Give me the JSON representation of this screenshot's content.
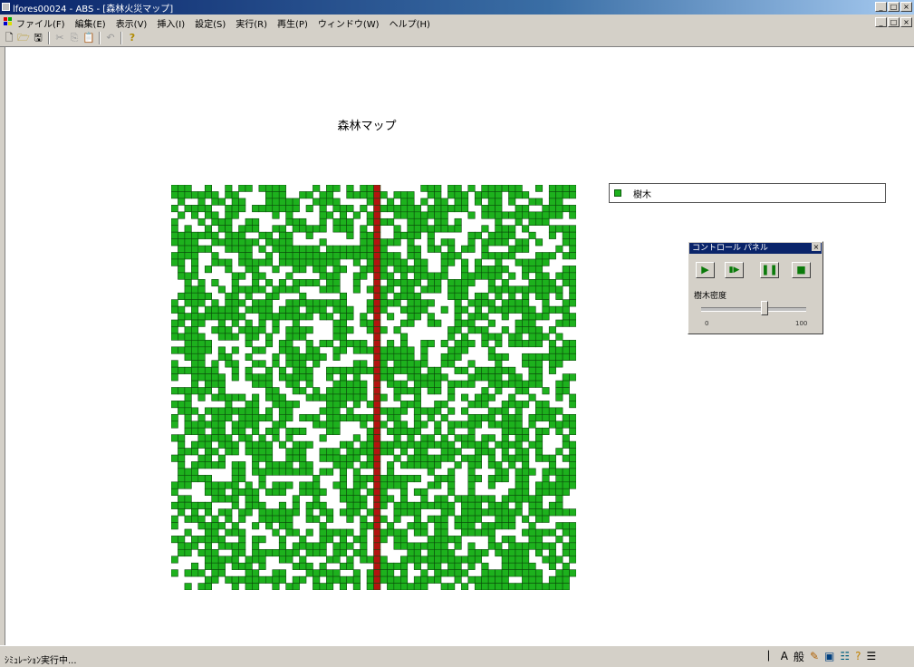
{
  "window": {
    "title": "lfores00024 - ABS - [森林火災マップ]",
    "controls": [
      "_",
      "□",
      "×"
    ],
    "mdi_controls": [
      "_",
      "□",
      "×"
    ]
  },
  "menubar": {
    "items": [
      "ファイル(F)",
      "編集(E)",
      "表示(V)",
      "挿入(I)",
      "設定(S)",
      "実行(R)",
      "再生(P)",
      "ウィンドウ(W)",
      "ヘルプ(H)"
    ]
  },
  "toolbar": {
    "icons": [
      "new-file-icon",
      "open-folder-icon",
      "save-icon",
      "cut-icon",
      "copy-icon",
      "paste-icon",
      "undo-icon",
      "help-icon"
    ]
  },
  "map": {
    "title": "森林マップ",
    "grid_size": 60,
    "fire_column": 30,
    "tree_color": "#1db11d",
    "fire_color": "#b31410"
  },
  "legend": {
    "label": "樹木",
    "color": "#1db11d"
  },
  "control_panel": {
    "title": "コントロール パネル",
    "close_label": "×",
    "buttons": [
      "play-icon",
      "step-icon",
      "pause-icon",
      "stop-icon"
    ],
    "glyphs": {
      "play": "▶",
      "step": "▮▶",
      "pause": "❚❚",
      "stop": "■"
    },
    "slider_label": "樹木密度",
    "slider_min": "0",
    "slider_max": "100",
    "slider_value": 0.6
  },
  "statusbar": {
    "text": "ｼﾐｭﾚｰｼｮﾝ実行中..."
  },
  "tray": [
    "ime-icon",
    "A",
    "般",
    "tray-icon-1",
    "tray-icon-2",
    "tray-icon-3",
    "tray-icon-4",
    "tray-icon-5"
  ]
}
